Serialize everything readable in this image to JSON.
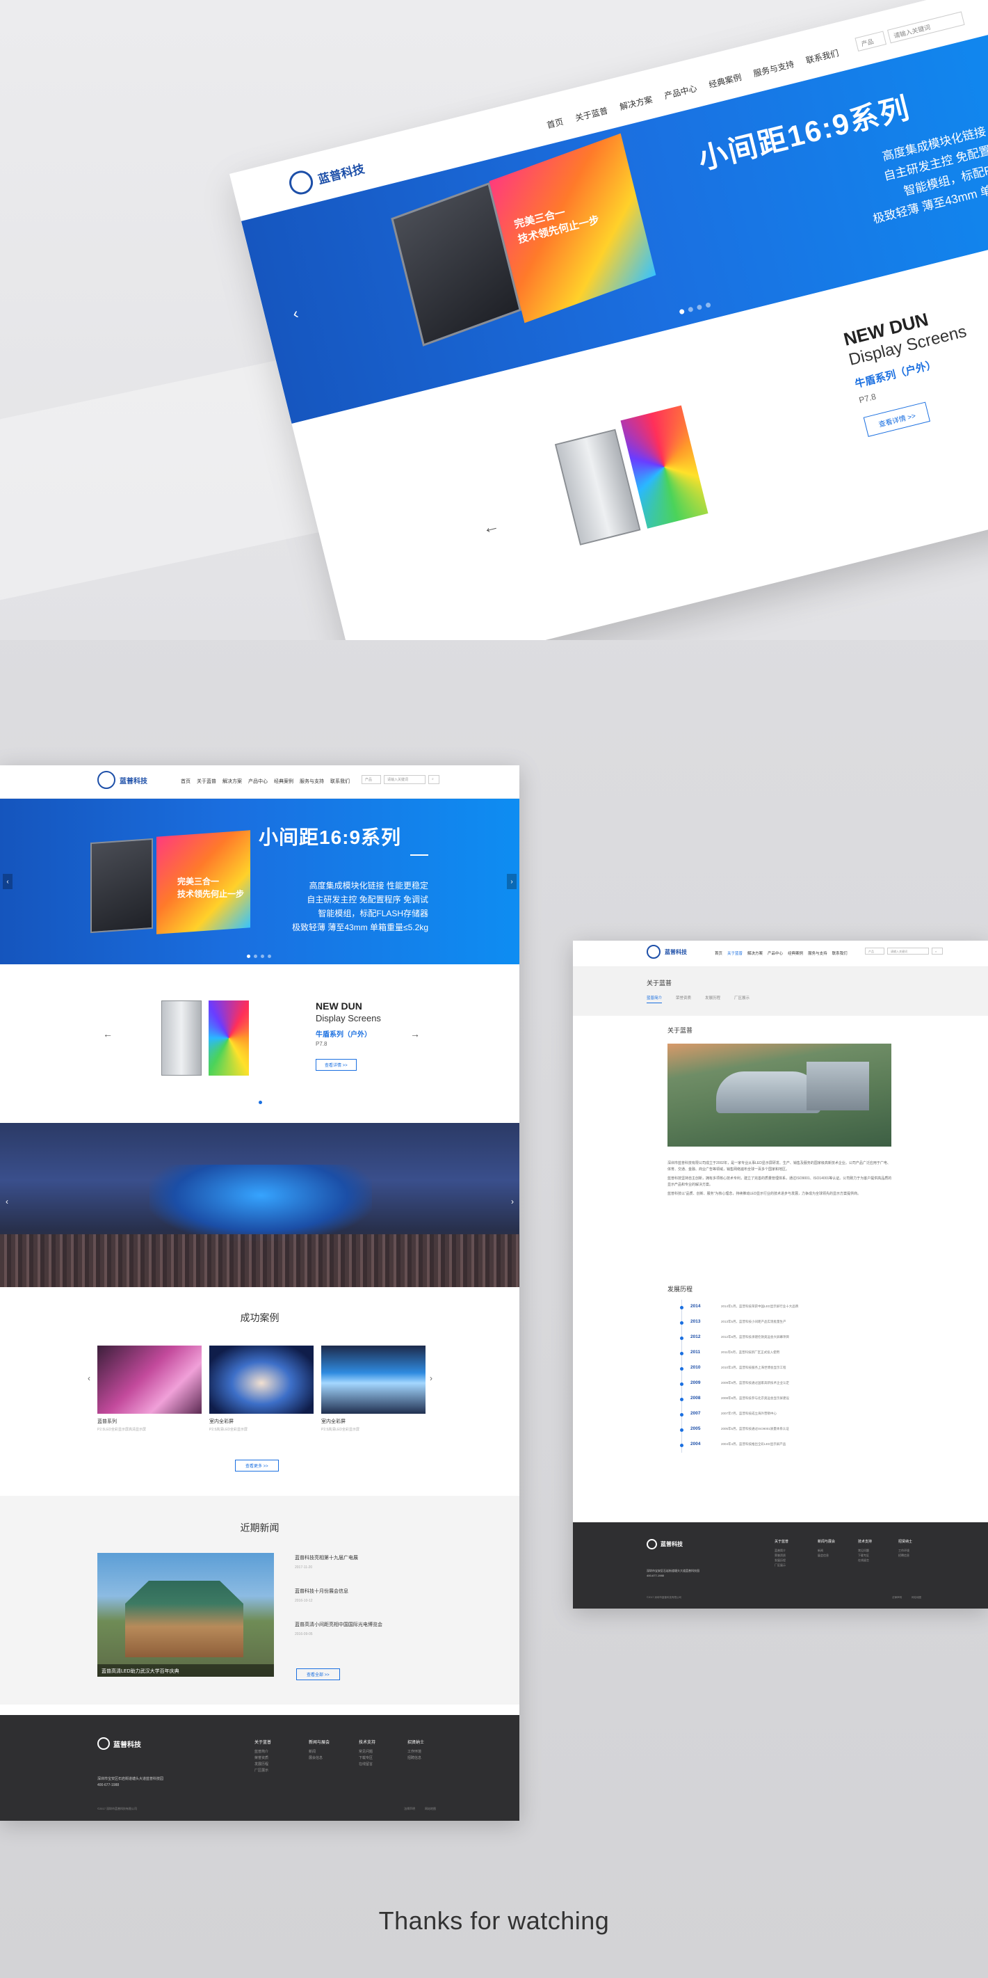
{
  "brand": {
    "name": "蓝普科技"
  },
  "nav": {
    "items": [
      "首页",
      "关于蓝普",
      "解决方案",
      "产品中心",
      "经典案例",
      "服务与支持",
      "联系我们"
    ],
    "search_select": "产品",
    "search_placeholder": "请输入关键词"
  },
  "hero": {
    "title": "小间距16:9系列",
    "screen_text_1": "完美三合一",
    "screen_text_2": "技术领先何止一步",
    "features": [
      "高度集成模块化链接 性能更稳定",
      "自主研发主控 免配置程序 免调试",
      "智能模组，标配FLASH存储器",
      "极致轻薄 薄至43mm 单箱重量≤5.2kg"
    ]
  },
  "product": {
    "name_1": "NEW DUN",
    "name_2": "Display Screens",
    "series": "牛盾系列（户外）",
    "model": "P7.8",
    "more": "查看详情 >>"
  },
  "cases": {
    "title": "成功案例",
    "items": [
      {
        "name": "蓝普系列",
        "desc": "P2.5LED全彩显示屏高清显示屏"
      },
      {
        "name": "室内全彩屏",
        "desc": "P2.5高清LED全彩显示屏"
      },
      {
        "name": "室内全彩屏",
        "desc": "P2.5高清LED全彩显示屏"
      }
    ],
    "more": "查看更多 >>"
  },
  "news": {
    "title": "近期新闻",
    "image_caption": "蓝普高清LED助力武汉大学百年庆典",
    "items": [
      {
        "title": "蓝普科技亮相第十九届广电展",
        "date": "2017-11-20"
      },
      {
        "title": "蓝普科技十月份展会信息",
        "date": "2016-10-12"
      },
      {
        "title": "蓝普高清小间距亮相中国国际光电博览会",
        "date": "2016-09-05"
      }
    ],
    "more": "查看全部 >>"
  },
  "footer": {
    "columns": [
      {
        "head": "关于蓝普",
        "items": [
          "蓝普简介",
          "荣誉资质",
          "发展历程",
          "厂区展示"
        ]
      },
      {
        "head": "新闻与展会",
        "items": [
          "新闻",
          "展会信息"
        ]
      },
      {
        "head": "技术支持",
        "items": [
          "常见问题",
          "下载专区",
          "在线留言"
        ]
      },
      {
        "head": "招贤纳士",
        "items": [
          "工作环境",
          "招聘信息"
        ]
      }
    ],
    "address": "深圳市宝安区石岩街道塘头大道蓝普科技园",
    "phone": "400-677-1988",
    "copyright": "©2017 深圳市蓝普科技有限公司",
    "links": [
      "法律声明",
      "网站地图"
    ]
  },
  "about": {
    "sub_title": "关于蓝普",
    "tabs": [
      "蓝普简介",
      "荣誉资质",
      "发展历程",
      "厂区展示"
    ],
    "heading": "关于蓝普",
    "paragraphs": [
      "深圳市蓝普科技有限公司成立于2002年，是一家专业从事LED显示屏研发、生产、销售及服务的国家级高新技术企业。公司产品广泛应用于广电、体育、交通、金融、商业广告等领域，销售网络遍布全球一百多个国家和地区。",
      "蓝普科技坚持自主创新，拥有多项核心技术专利，建立了完善的质量管理体系，通过ISO9001、ISO14001等认证。公司致力于为客户提供高品质的显示产品和专业的解决方案。",
      "蓝普科技以“品质、创新、服务”为核心理念，持续推动LED显示行业的技术进步与发展，力争成为全球领先的显示方案提供商。"
    ],
    "history_heading": "发展历程",
    "timeline": [
      {
        "year": "2014",
        "text": "2014年1月，蓝普科技荣获中国LED显示屏行业十大品牌"
      },
      {
        "year": "2013",
        "text": "2013年5月，蓝普科技小间距产品实现批量生产"
      },
      {
        "year": "2012",
        "text": "2012年8月，蓝普科技承建伦敦奥运会大屏幕项目"
      },
      {
        "year": "2011",
        "text": "2011年6月，蓝普科技新厂区正式投入使用"
      },
      {
        "year": "2010",
        "text": "2010年3月，蓝普科技服务上海世博会显示工程"
      },
      {
        "year": "2009",
        "text": "2009年9月，蓝普科技通过国家高新技术企业认定"
      },
      {
        "year": "2008",
        "text": "2008年8月，蓝普科技参与北京奥运会显示屏建设"
      },
      {
        "year": "2007",
        "text": "2007年7月，蓝普科技成立海外营销中心"
      },
      {
        "year": "2005",
        "text": "2005年5月，蓝普科技通过ISO9001质量体系认证"
      },
      {
        "year": "2004",
        "text": "2004年4月，蓝普科技推出全彩LED显示屏产品"
      }
    ]
  },
  "thanks": "Thanks for watching",
  "colors": {
    "accent": "#1a6fe0",
    "brand": "#1d4fa8",
    "footer": "#2f2f31"
  }
}
